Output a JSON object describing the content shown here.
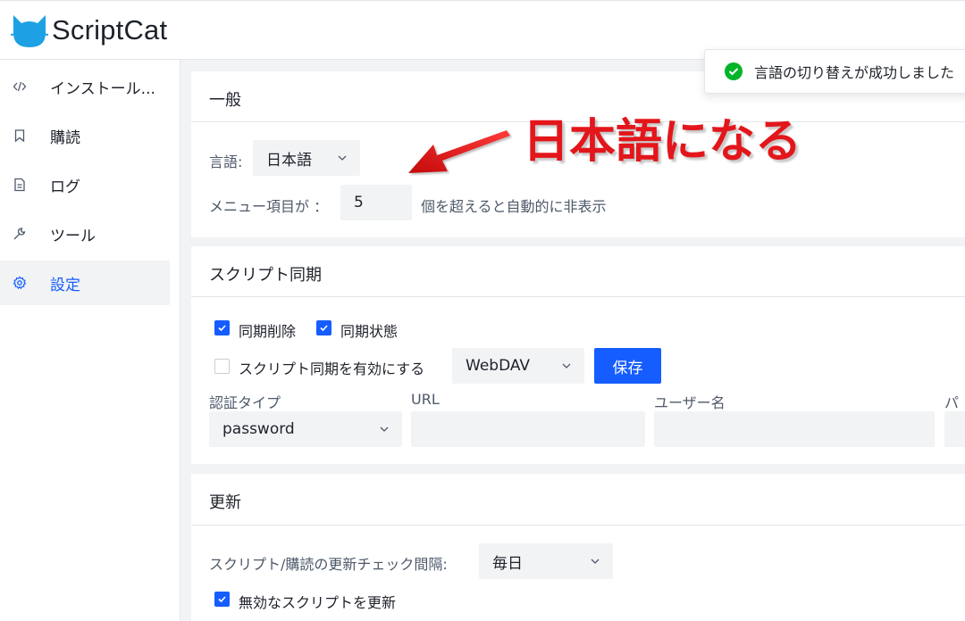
{
  "app": {
    "title": "ScriptCat"
  },
  "sidebar": {
    "items": [
      {
        "label": "インストール...",
        "icon": "code-icon",
        "active": false
      },
      {
        "label": "購読",
        "icon": "bookmark-icon",
        "active": false
      },
      {
        "label": "ログ",
        "icon": "file-icon",
        "active": false
      },
      {
        "label": "ツール",
        "icon": "wrench-icon",
        "active": false
      },
      {
        "label": "設定",
        "icon": "gear-icon",
        "active": true
      }
    ]
  },
  "toast": {
    "text": "言語の切り替えが成功しました",
    "icon": "check-circle-icon"
  },
  "annotation": {
    "text": "日本語になる"
  },
  "general": {
    "title": "一般",
    "language_label": "言語:",
    "language_value": "日本語",
    "menu_label": "メニュー項目が ：",
    "menu_value": "5",
    "menu_suffix": "個を超えると自動的に非表示"
  },
  "sync": {
    "title": "スクリプト同期",
    "sync_delete_label": "同期削除",
    "sync_delete_checked": true,
    "sync_state_label": "同期状態",
    "sync_state_checked": true,
    "enable_label": "スクリプト同期を有効にする",
    "enable_checked": false,
    "type_value": "WebDAV",
    "save_label": "保存",
    "auth_type_label": "認証タイプ",
    "auth_type_value": "password",
    "url_label": "URL",
    "url_value": "",
    "username_label": "ユーザー名",
    "username_value": "",
    "password_label": "パ"
  },
  "update": {
    "title": "更新",
    "interval_label": "スクリプト/購読の更新チェック間隔:",
    "interval_value": "毎日",
    "update_disabled_label": "無効なスクリプトを更新",
    "update_disabled_checked": true
  },
  "colors": {
    "primary": "#165dff",
    "success": "#00b42a",
    "annotation": "#e3161b",
    "page_bg": "#f2f3f5"
  }
}
